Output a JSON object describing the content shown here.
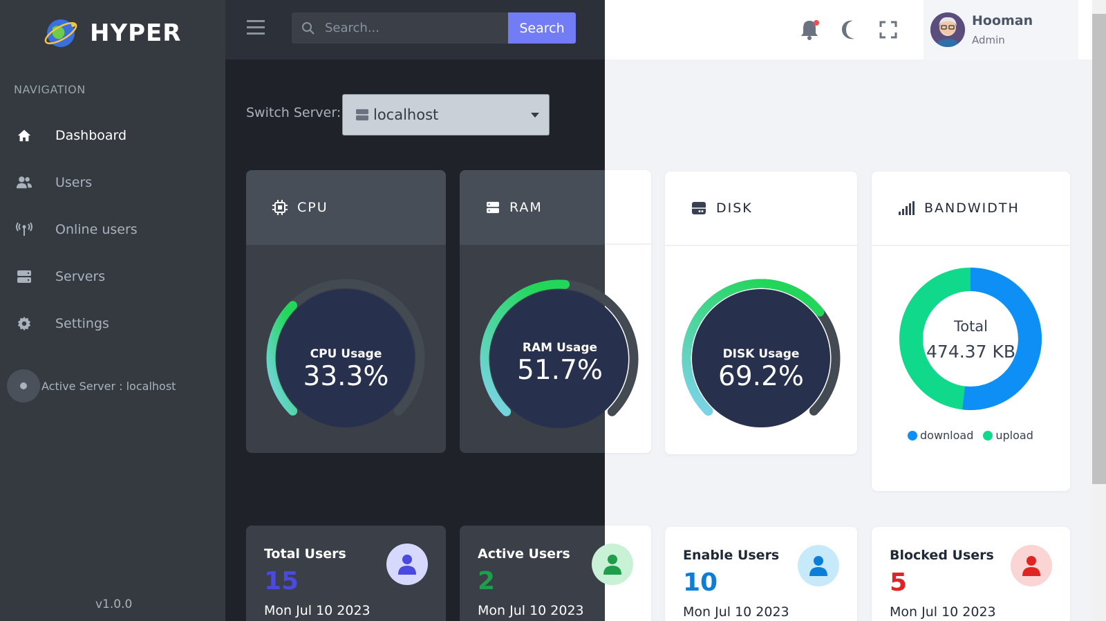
{
  "brand": {
    "name": "HYPER"
  },
  "sidebar": {
    "section_title": "NAVIGATION",
    "items": [
      {
        "label": "Dashboard",
        "icon": "home-icon",
        "active": true
      },
      {
        "label": "Users",
        "icon": "users-icon"
      },
      {
        "label": "Online users",
        "icon": "broadcast-icon"
      },
      {
        "label": "Servers",
        "icon": "server-icon"
      },
      {
        "label": "Settings",
        "icon": "gear-icon"
      }
    ],
    "active_server": "Active Server : localhost",
    "version": "v1.0.0"
  },
  "search": {
    "placeholder": "Search...",
    "button_label": "Search"
  },
  "user": {
    "name": "Hooman",
    "role": "Admin"
  },
  "server_switch": {
    "label": "Switch Server:",
    "selected": "localhost"
  },
  "cards": {
    "cpu": {
      "title": "CPU",
      "gauge_label": "CPU Usage",
      "value_text": "33.3%",
      "value": 33.3
    },
    "ram": {
      "title": "RAM",
      "gauge_label": "RAM Usage",
      "value_text": "51.7%",
      "value": 51.7
    },
    "disk": {
      "title": "DISK",
      "gauge_label": "DISK Usage",
      "value_text": "69.2%",
      "value": 69.2
    },
    "bandwidth": {
      "title": "BANDWIDTH",
      "total_label": "Total",
      "total_value": "474.37 KB",
      "legend": [
        {
          "label": "download",
          "color": "#0d8ff5"
        },
        {
          "label": "upload",
          "color": "#10d98c"
        }
      ]
    }
  },
  "stats": [
    {
      "title": "Total Users",
      "value": "15",
      "date": "Mon Jul 10 2023",
      "color": "#4a49e0",
      "bg": "#d6d9fb"
    },
    {
      "title": "Active Users",
      "value": "2",
      "date": "Mon Jul 10 2023",
      "color": "#1e9e4b",
      "bg": "#c8f1d6"
    },
    {
      "title": "Enable Users",
      "value": "10",
      "date": "Mon Jul 10 2023",
      "color": "#0d7ed8",
      "bg": "#c7eafb"
    },
    {
      "title": "Blocked Users",
      "value": "5",
      "date": "Mon Jul 10 2023",
      "color": "#e02424",
      "bg": "#fbd4d4"
    }
  ],
  "colors": {
    "accent": "#727cf5",
    "gauge_green": "#22d65a",
    "gauge_cyan": "#7fd4ef",
    "gauge_bg": "#27304d"
  }
}
